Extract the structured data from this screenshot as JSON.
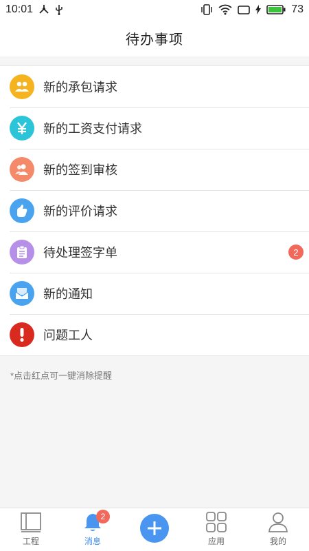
{
  "status_bar": {
    "time": "10:01",
    "battery_level": "73"
  },
  "header": {
    "title": "待办事项"
  },
  "todo_items": [
    {
      "label": "新的承包请求",
      "icon": "people-icon",
      "color": "#f5b320"
    },
    {
      "label": "新的工资支付请求",
      "icon": "yen-icon",
      "color": "#2cc4d8"
    },
    {
      "label": "新的签到审核",
      "icon": "people-icon",
      "color": "#f58a6a"
    },
    {
      "label": "新的评价请求",
      "icon": "thumb-up-icon",
      "color": "#4aa3ee"
    },
    {
      "label": "待处理签字单",
      "icon": "clipboard-icon",
      "color": "#b58fe8",
      "badge": "2"
    },
    {
      "label": "新的通知",
      "icon": "mail-icon",
      "color": "#4aa3ee"
    },
    {
      "label": "问题工人",
      "icon": "exclamation-icon",
      "color": "#d82a1e"
    }
  ],
  "hint": "*点击红点可一键消除提醒",
  "tab_bar": {
    "tabs": [
      {
        "label": "工程",
        "icon": "project-icon"
      },
      {
        "label": "消息",
        "icon": "bell-icon",
        "badge": "2",
        "active": true
      },
      {
        "label": "",
        "icon": "plus-icon"
      },
      {
        "label": "应用",
        "icon": "grid-icon"
      },
      {
        "label": "我的",
        "icon": "user-icon"
      }
    ]
  }
}
